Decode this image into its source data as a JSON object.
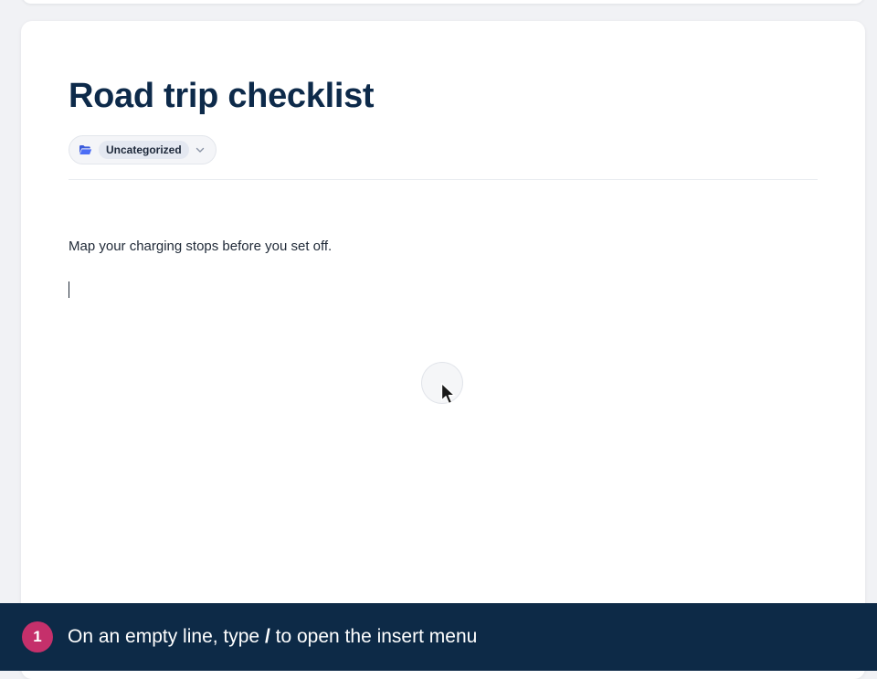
{
  "document": {
    "title": "Road trip checklist",
    "category": "Uncategorized",
    "body_paragraph": "Map your charging stops before you set off."
  },
  "icons": {
    "folder": "folder-open-icon",
    "dropdown": "chevron-down-icon",
    "pointer": "mouse-pointer-icon"
  },
  "tutorial": {
    "step_number": "1",
    "instruction_before": "On an empty line, type",
    "instruction_key": "/",
    "instruction_after": "to open the insert menu"
  },
  "colors": {
    "title": "#0d2a4a",
    "folder_icon": "#3b5bdb",
    "instruction_bar": "#0d2a47",
    "step_badge": "#c5306b"
  }
}
